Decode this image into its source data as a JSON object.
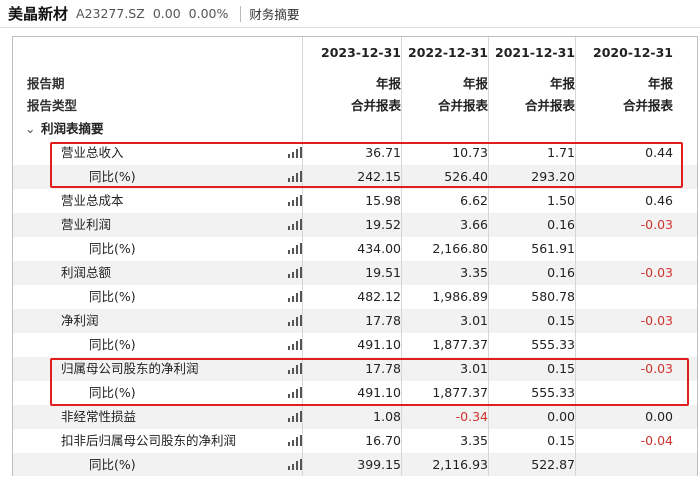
{
  "header": {
    "company": "美晶新材",
    "code": "A23277.SZ",
    "price": "0.00",
    "change_pct": "0.00%",
    "tab": "财务摘要"
  },
  "table": {
    "period_label": "报告期",
    "type_label": "报告类型",
    "columns": [
      {
        "date": "2023-12-31",
        "kind": "年报",
        "scope": "合并报表"
      },
      {
        "date": "2022-12-31",
        "kind": "年报",
        "scope": "合并报表"
      },
      {
        "date": "2021-12-31",
        "kind": "年报",
        "scope": "合并报表"
      },
      {
        "date": "2020-12-31",
        "kind": "年报",
        "scope": "合并报表"
      }
    ],
    "section": "利润表摘要",
    "rows": [
      {
        "label": "营业总收入",
        "indent": 1,
        "values": [
          "36.71",
          "10.73",
          "1.71",
          "0.44"
        ]
      },
      {
        "label": "同比(%)",
        "indent": 2,
        "values": [
          "242.15",
          "526.40",
          "293.20",
          ""
        ]
      },
      {
        "label": "营业总成本",
        "indent": 1,
        "values": [
          "15.98",
          "6.62",
          "1.50",
          "0.46"
        ]
      },
      {
        "label": "营业利润",
        "indent": 1,
        "values": [
          "19.52",
          "3.66",
          "0.16",
          "-0.03"
        ]
      },
      {
        "label": "同比(%)",
        "indent": 2,
        "values": [
          "434.00",
          "2,166.80",
          "561.91",
          ""
        ]
      },
      {
        "label": "利润总额",
        "indent": 1,
        "values": [
          "19.51",
          "3.35",
          "0.16",
          "-0.03"
        ]
      },
      {
        "label": "同比(%)",
        "indent": 2,
        "values": [
          "482.12",
          "1,986.89",
          "580.78",
          ""
        ]
      },
      {
        "label": "净利润",
        "indent": 1,
        "values": [
          "17.78",
          "3.01",
          "0.15",
          "-0.03"
        ]
      },
      {
        "label": "同比(%)",
        "indent": 2,
        "values": [
          "491.10",
          "1,877.37",
          "555.33",
          ""
        ]
      },
      {
        "label": "归属母公司股东的净利润",
        "indent": 1,
        "values": [
          "17.78",
          "3.01",
          "0.15",
          "-0.03"
        ]
      },
      {
        "label": "同比(%)",
        "indent": 2,
        "values": [
          "491.10",
          "1,877.37",
          "555.33",
          ""
        ]
      },
      {
        "label": "非经常性损益",
        "indent": 1,
        "values": [
          "1.08",
          "-0.34",
          "0.00",
          "0.00"
        ]
      },
      {
        "label": "扣非后归属母公司股东的净利润",
        "indent": 1,
        "values": [
          "16.70",
          "3.35",
          "0.15",
          "-0.04"
        ]
      },
      {
        "label": "同比(%)",
        "indent": 2,
        "values": [
          "399.15",
          "2,116.93",
          "522.87",
          ""
        ]
      }
    ]
  },
  "colors": {
    "negative": "#d0342c",
    "highlight_box": "#e01e1e",
    "row_alt": "#f2f2f2"
  },
  "icons": [
    "bar-chart-icon",
    "chevron-down-icon"
  ]
}
